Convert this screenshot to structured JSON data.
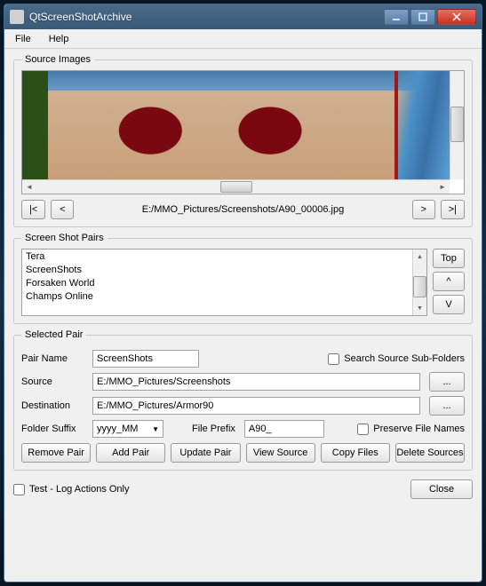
{
  "window": {
    "title": "QtScreenShotArchive"
  },
  "menu": {
    "file": "File",
    "help": "Help"
  },
  "source_images": {
    "legend": "Source Images",
    "path": "E:/MMO_Pictures/Screenshots/A90_00006.jpg",
    "first": "|<",
    "prev": "<",
    "next": ">",
    "last": ">|"
  },
  "pairs": {
    "legend": "Screen Shot Pairs",
    "items": [
      "Tera",
      "ScreenShots",
      "Forsaken World",
      "Champs Online"
    ],
    "top": "Top",
    "up": "^",
    "down": "V"
  },
  "selected": {
    "legend": "Selected Pair",
    "pair_name_label": "Pair Name",
    "pair_name_value": "ScreenShots",
    "search_sub": "Search Source Sub-Folders",
    "source_label": "Source",
    "source_value": "E:/MMO_Pictures/Screenshots",
    "dest_label": "Destination",
    "dest_value": "E:/MMO_Pictures/Armor90",
    "folder_suffix_label": "Folder Suffix",
    "folder_suffix_value": "yyyy_MM",
    "file_prefix_label": "File Prefix",
    "file_prefix_value": "A90_",
    "preserve": "Preserve File Names",
    "browse": "...",
    "buttons": {
      "remove": "Remove Pair",
      "add": "Add Pair",
      "update": "Update Pair",
      "view": "View Source",
      "copy": "Copy Files",
      "delete": "Delete Sources"
    }
  },
  "footer": {
    "test": "Test - Log Actions Only",
    "close": "Close"
  }
}
